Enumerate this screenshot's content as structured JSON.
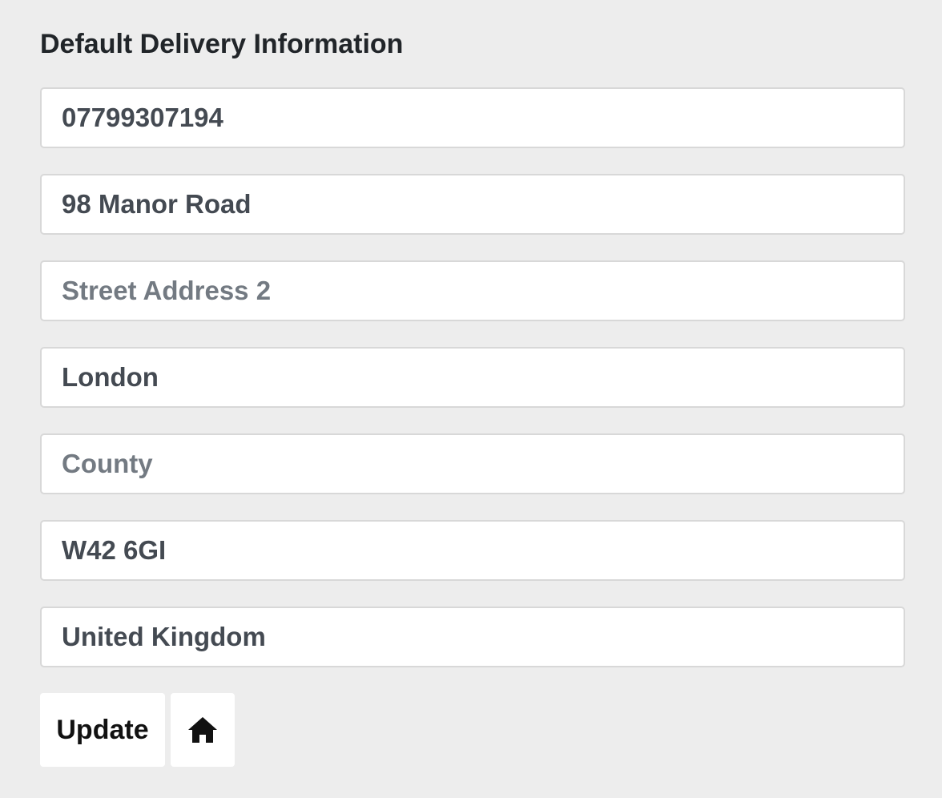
{
  "section": {
    "title": "Default Delivery Information"
  },
  "fields": {
    "phone": {
      "value": "07799307194",
      "placeholder": ""
    },
    "street_address_1": {
      "value": "98 Manor Road",
      "placeholder": ""
    },
    "street_address_2": {
      "value": "",
      "placeholder": "Street Address 2"
    },
    "town_or_city": {
      "value": "London",
      "placeholder": ""
    },
    "county": {
      "value": "",
      "placeholder": "County"
    },
    "postcode": {
      "value": "W42 6GI",
      "placeholder": ""
    },
    "country": {
      "value": "United Kingdom",
      "placeholder": ""
    }
  },
  "actions": {
    "update_label": "Update",
    "home_icon": "home-icon"
  }
}
